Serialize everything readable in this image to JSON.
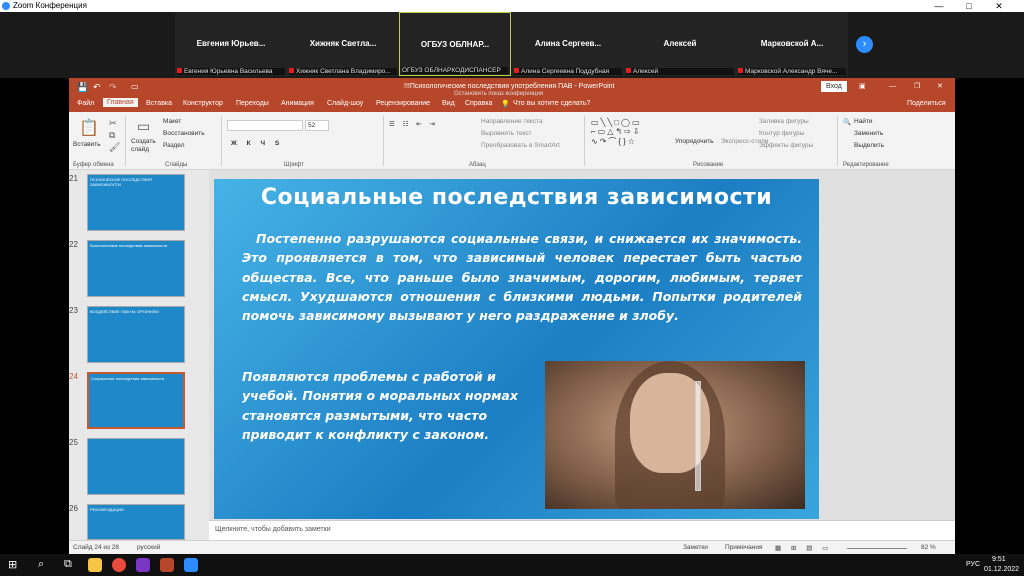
{
  "zoom": {
    "title": "Zoom Конференция",
    "win_controls": [
      "—",
      "□",
      "✕"
    ]
  },
  "participants": [
    {
      "name": "Евгения Юрьев...",
      "full": "Евгения Юрьевна Васильева"
    },
    {
      "name": "Хижняк Светла...",
      "full": "Хижняк Светлана Владимиро..."
    },
    {
      "name": "ОГБУЗ ОБЛНАР...",
      "full": "ОГБУЗ ОБЛНАРКОДИСПАНСЕР"
    },
    {
      "name": "Алина Сергеев...",
      "full": "Алина Сергеевна Поддубная"
    },
    {
      "name": "Алексей",
      "full": "Алексей"
    },
    {
      "name": "Марковской А...",
      "full": "Марковской Александр Вяче..."
    }
  ],
  "ppt": {
    "title": "!!!Психологические последствия употребления ПАВ  -  PowerPoint",
    "tooltip": "Остановить показ конференции",
    "login": "Вход",
    "share": "Поделиться",
    "menu": [
      "Файл",
      "Главная",
      "Вставка",
      "Конструктор",
      "Переходы",
      "Анимация",
      "Слайд-шоу",
      "Рецензирование",
      "Вид",
      "Справка"
    ],
    "search": "Что вы хотите сделать?",
    "ribbon": {
      "paste": "Вставить",
      "create_slide": "Создать слайд",
      "layout": "Макет",
      "restore": "Восстановить",
      "section": "Раздел",
      "font_size": "52",
      "text_dir": "Направление текста",
      "align_text": "Выровнять текст",
      "smartart": "Преобразовать в SmartArt",
      "arrange": "Упорядочить",
      "quick_styles": "Экспресс-стили",
      "fill": "Заливка фигуры",
      "outline": "Контур фигуры",
      "effects": "Эффекты фигуры",
      "find": "Найти",
      "replace": "Заменить",
      "select": "Выделить",
      "groups": [
        "Буфер обмена",
        "Слайды",
        "Шрифт",
        "Абзац",
        "Рисование",
        "Редактирование"
      ]
    },
    "thumbs": [
      {
        "num": "21",
        "text": "ПСИХИЧЕСКИЕ ПОСЛЕДСТВИЯ ЗАВИСИМОСТИ"
      },
      {
        "num": "22",
        "text": "Биологические последствия зависимости"
      },
      {
        "num": "23",
        "text": "ВОЗДЕЙСТВИЕ ПАВ НА ОРГАНИЗМ"
      },
      {
        "num": "24",
        "text": "Социальные последствия зависимости"
      },
      {
        "num": "25",
        "text": ""
      },
      {
        "num": "26",
        "text": "РЕКОМЕНДАЦИИ"
      }
    ],
    "slide": {
      "title": "Социальные последствия зависимости",
      "body": "Постепенно разрушаются социальные связи, и снижается их значимость. Это проявляется в том, что зависимый человек перестает быть частью общества. Все, что раньше было значимым, дорогим, любимым, теряет смысл. Ухудшаются отношения с близкими людьми. Попытки родителей помочь зависимому вызывают у него раздражение и злобу.",
      "body2": "Появляются проблемы с работой и учебой. Понятия о моральных нормах становятся размытыми, что часто приводит к конфликту с законом."
    },
    "notes": "Щелкните, чтобы добавить заметки",
    "status": {
      "slide": "Слайд 24 из 28",
      "lang": "русский",
      "notes_btn": "Заметки",
      "comments_btn": "Примечания",
      "zoom": "82 %"
    }
  },
  "taskbar": {
    "lang": "РУС",
    "time": "9:51",
    "date": "01.12.2022"
  }
}
